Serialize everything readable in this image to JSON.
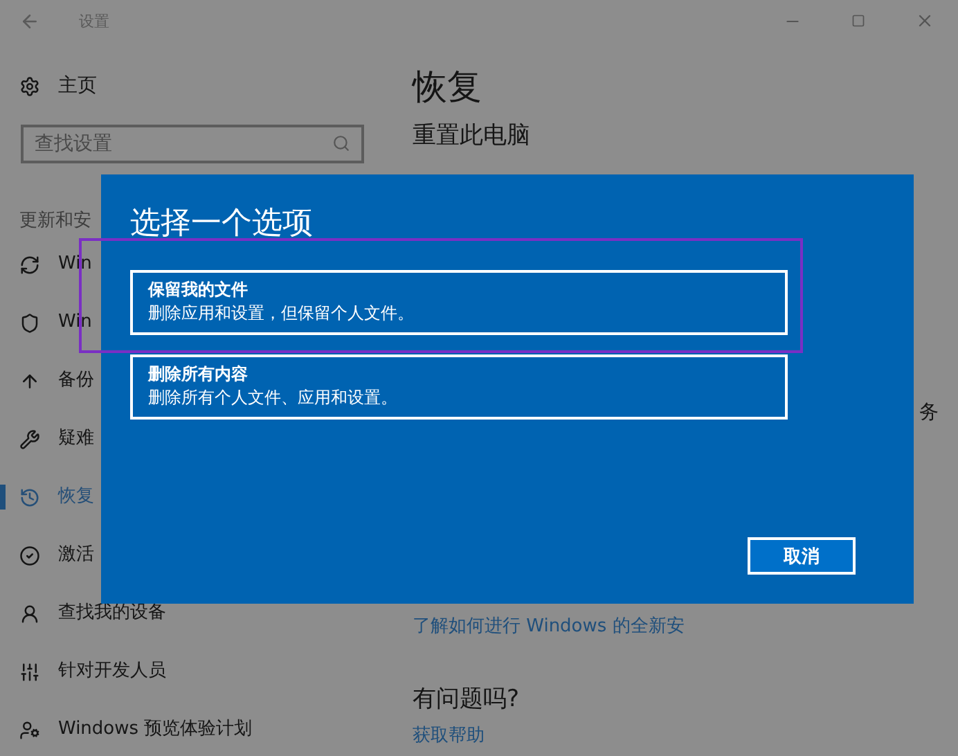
{
  "window": {
    "title": "设置"
  },
  "sidebar": {
    "home": "主页",
    "search": {
      "placeholder": "查找设置"
    },
    "section": "更新和安",
    "items": [
      {
        "label": "Win",
        "selected": false
      },
      {
        "label": "Win",
        "selected": false
      },
      {
        "label": "备份",
        "selected": false
      },
      {
        "label": "疑难",
        "selected": false
      },
      {
        "label": "恢复",
        "selected": true
      },
      {
        "label": "激活",
        "selected": false
      },
      {
        "label": "查找我的设备",
        "selected": false
      },
      {
        "label": "针对开发人员",
        "selected": false
      },
      {
        "label": "Windows 预览体验计划",
        "selected": false
      }
    ]
  },
  "main": {
    "title": "恢复",
    "subtitle": "重置此电脑",
    "fragment": "务",
    "link": "了解如何进行 Windows 的全新安",
    "question": "有问题吗?",
    "help_link": "获取帮助"
  },
  "dialog": {
    "title": "选择一个选项",
    "options": [
      {
        "title": "保留我的文件",
        "description": "删除应用和设置，但保留个人文件。"
      },
      {
        "title": "删除所有内容",
        "description": "删除所有个人文件、应用和设置。"
      }
    ],
    "cancel": "取消"
  }
}
